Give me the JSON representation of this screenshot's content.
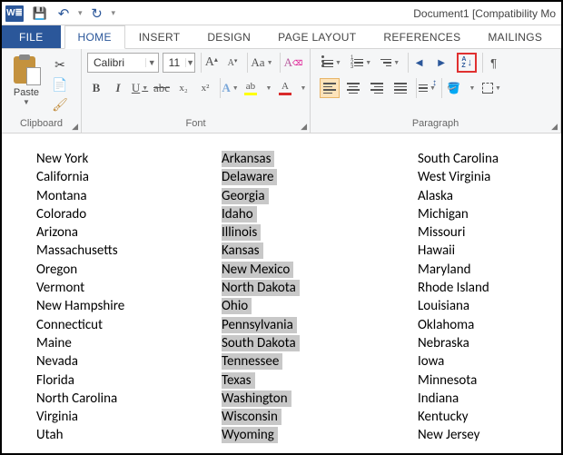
{
  "titlebar": {
    "app_glyph": "W≣",
    "doc_title": "Document1 [Compatibility Mo"
  },
  "tabs": {
    "file": "FILE",
    "home": "HOME",
    "insert": "INSERT",
    "design": "DESIGN",
    "page_layout": "PAGE LAYOUT",
    "references": "REFERENCES",
    "mailings": "MAILINGS"
  },
  "ribbon": {
    "clipboard": {
      "label": "Clipboard",
      "paste": "Paste"
    },
    "font": {
      "label": "Font",
      "name": "Calibri",
      "size": "11",
      "grow": "A",
      "shrink": "A",
      "case": "Aa",
      "clear": "A",
      "bold": "B",
      "italic": "I",
      "underline": "U",
      "strike": "abc",
      "sub": "x₂",
      "sup": "x²",
      "fx": "A",
      "highlight": "ab",
      "fontcolor": "A"
    },
    "paragraph": {
      "label": "Paragraph",
      "sort_a": "A",
      "sort_z": "Z",
      "pilcrow": "¶"
    }
  },
  "document": {
    "col1": [
      "New York",
      "California",
      "Montana",
      "Colorado",
      "Arizona",
      "Massachusetts",
      "Oregon",
      "Vermont",
      "New Hampshire",
      "Connecticut",
      "Maine",
      "Nevada",
      "Florida",
      "North Carolina",
      "Virginia",
      "Utah"
    ],
    "col2": [
      "Arkansas",
      "Delaware",
      "Georgia",
      "Idaho",
      "Illinois",
      "Kansas",
      "New Mexico",
      "North Dakota",
      "Ohio",
      "Pennsylvania",
      "South Dakota",
      "Tennessee",
      "Texas",
      "Washington",
      "Wisconsin",
      "Wyoming"
    ],
    "col3": [
      "South Carolina",
      "West Virginia",
      "Alaska",
      "Michigan",
      "Missouri",
      "Hawaii",
      "Maryland",
      "Rhode Island",
      "Louisiana",
      "Oklahoma",
      "Nebraska",
      "Iowa",
      "Minnesota",
      "Indiana",
      "Kentucky",
      "New Jersey"
    ]
  }
}
